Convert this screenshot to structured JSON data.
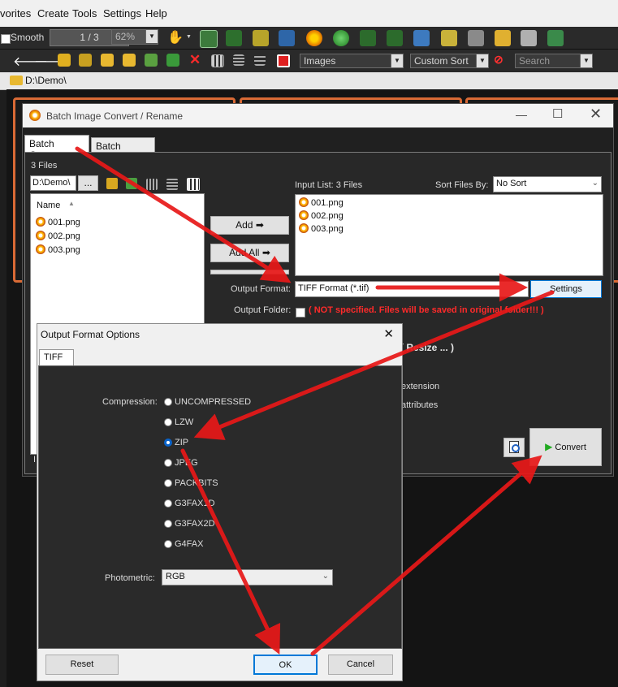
{
  "menu": [
    "vorites",
    "Create",
    "Tools",
    "Settings",
    "Help"
  ],
  "toolbar": {
    "smooth_label": "Smooth",
    "page_value": "1 / 3",
    "zoom_value": "62%"
  },
  "toolbar2": {
    "filter_value": "Images",
    "sort_value": "Custom Sort",
    "search_placeholder": "Search"
  },
  "path": "D:\\Demo\\",
  "batch": {
    "title": "Batch Image Convert / Rename",
    "tabs": [
      "Batch Convert",
      "Batch Rename"
    ],
    "files_count": "3 Files",
    "folder_value": "D:\\Demo\\",
    "browse_label": "...",
    "name_header": "Name",
    "files": [
      "001.png",
      "002.png",
      "003.png"
    ],
    "add_label": "Add",
    "add_all_label": "Add All",
    "input_list_label": "Input List:  3 Files",
    "sort_by_label": "Sort Files By:",
    "sort_value": "No Sort",
    "input_files": [
      "001.png",
      "002.png",
      "003.png"
    ],
    "output_format_label": "Output Format:",
    "output_format_value": "TIFF Format (*.tif)",
    "settings_label": "Settings",
    "output_folder_label": "Output Folder:",
    "output_folder_note": "( NOT specified.  Files will be saved in original folder!!! )",
    "partial_resize": "s ( Resize ... )",
    "partial_extension": "extension",
    "partial_attributes": "attributes",
    "convert_label": "Convert",
    "partial_left": "I"
  },
  "options": {
    "title": "Output Format Options",
    "tab": "TIFF",
    "compression_label": "Compression:",
    "compression_options": [
      "UNCOMPRESSED",
      "LZW",
      "ZIP",
      "JPEG",
      "PACKBITS",
      "G3FAX1D",
      "G3FAX2D",
      "G4FAX"
    ],
    "selected_compression": "ZIP",
    "photometric_label": "Photometric:",
    "photometric_value": "RGB",
    "reset_label": "Reset",
    "ok_label": "OK",
    "cancel_label": "Cancel"
  },
  "colors": {
    "accent_orange": "#d96a35",
    "annotation_red": "#e81818",
    "selection_blue": "#0a63c9"
  }
}
